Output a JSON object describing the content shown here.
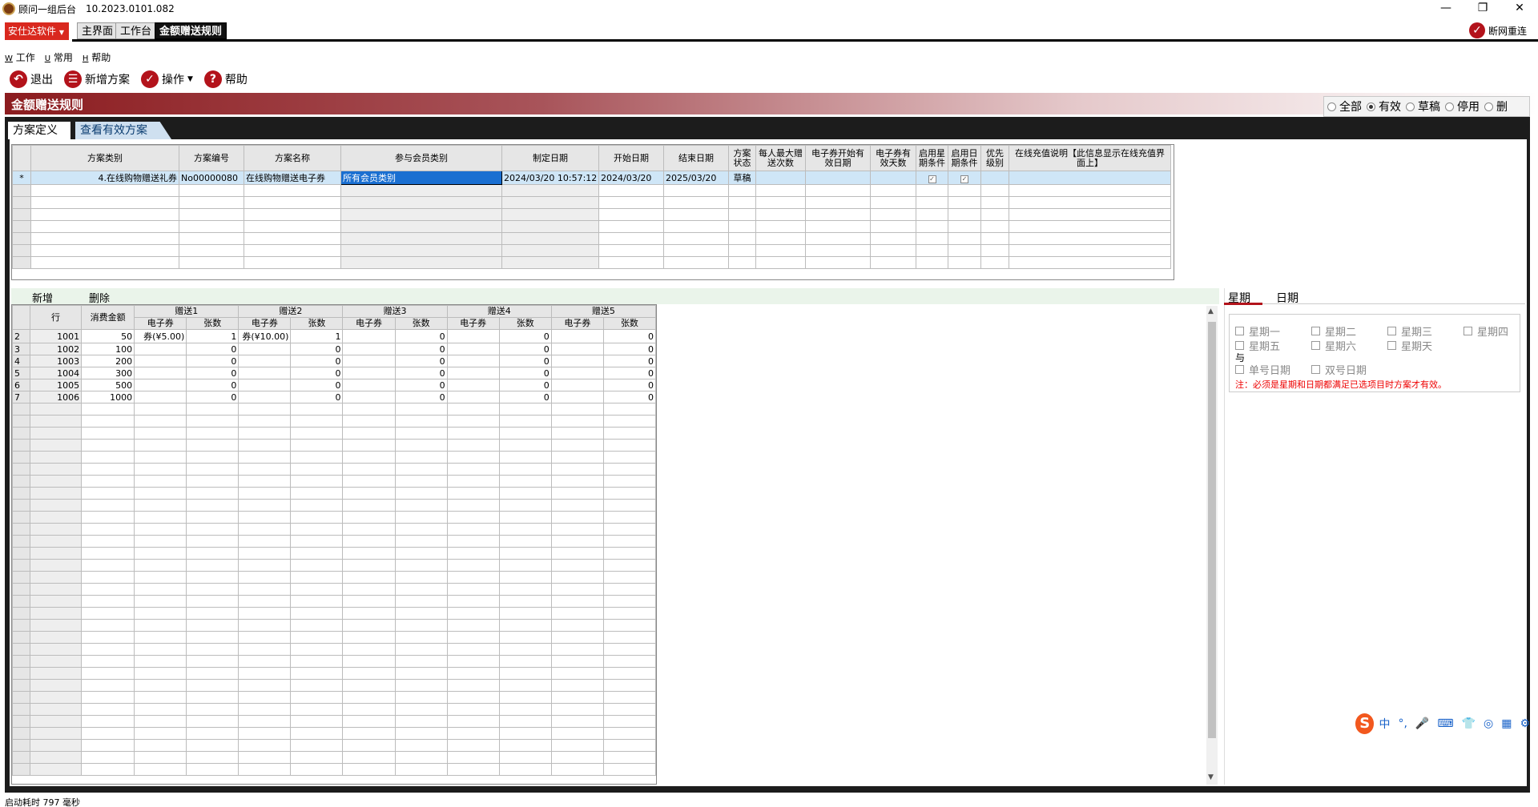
{
  "window": {
    "title": "顾问一组后台",
    "version": "10.2023.0101.082",
    "min": "—",
    "restore": "❐",
    "close": "✕"
  },
  "app_tabs": {
    "brand": "安仕达软件",
    "tabs": [
      {
        "label": "主界面"
      },
      {
        "label": "工作台"
      },
      {
        "label": "金额赠送规则"
      }
    ],
    "reconnect": "断网重连"
  },
  "menu": [
    {
      "key": "W",
      "label": "工作"
    },
    {
      "key": "U",
      "label": "常用"
    },
    {
      "key": "H",
      "label": "帮助"
    }
  ],
  "toolbar": {
    "exit": "退出",
    "new_plan": "新增方案",
    "operate": "操作",
    "help": "帮助"
  },
  "banner": {
    "title": "金额赠送规则"
  },
  "filter": {
    "options": [
      "全部",
      "有效",
      "草稿",
      "停用",
      "删"
    ],
    "selected": "有效"
  },
  "subtabs": {
    "define": "方案定义",
    "view_valid": "查看有效方案"
  },
  "plan_grid": {
    "headers": [
      "方案类别",
      "方案编号",
      "方案名称",
      "参与会员类别",
      "制定日期",
      "开始日期",
      "结束日期",
      "方案状态",
      "每人最大赠送次数",
      "电子券开始有效日期",
      "电子券有效天数",
      "启用星期条件",
      "启用日期条件",
      "优先级别",
      "在线充值说明【此信息显示在线充值界面上】"
    ],
    "row": {
      "marker": "*",
      "category": "4.在线购物赠送礼券",
      "code": "No00000080",
      "name": "在线购物赠送电子券",
      "member": "所有会员类别",
      "made": "2024/03/20 10:57:12",
      "start": "2024/03/20",
      "end": "2025/03/20",
      "status": "草稿",
      "max": "",
      "coupon_start": "",
      "days": "",
      "week_on": true,
      "date_on": true,
      "priority": "",
      "note": ""
    }
  },
  "detail_toolbar": {
    "add": "新增",
    "delete": "删除"
  },
  "detail_grid": {
    "h_row": "行",
    "h_amount": "消费金额",
    "groups": [
      "赠送1",
      "赠送2",
      "赠送3",
      "赠送4",
      "赠送5"
    ],
    "sub_coupon": "电子券",
    "sub_count": "张数",
    "rows": [
      {
        "idx": "2",
        "row": "1001",
        "amount": "50",
        "c": [
          "券(¥5.00)",
          "券(¥10.00)",
          "",
          "",
          ""
        ],
        "n": [
          "1",
          "1",
          "0",
          "0",
          "0"
        ]
      },
      {
        "idx": "3",
        "row": "1002",
        "amount": "100",
        "c": [
          "",
          "",
          "",
          "",
          ""
        ],
        "n": [
          "0",
          "0",
          "0",
          "0",
          "0"
        ]
      },
      {
        "idx": "4",
        "row": "1003",
        "amount": "200",
        "c": [
          "",
          "",
          "",
          "",
          ""
        ],
        "n": [
          "0",
          "0",
          "0",
          "0",
          "0"
        ]
      },
      {
        "idx": "5",
        "row": "1004",
        "amount": "300",
        "c": [
          "",
          "",
          "",
          "",
          ""
        ],
        "n": [
          "0",
          "0",
          "0",
          "0",
          "0"
        ]
      },
      {
        "idx": "6",
        "row": "1005",
        "amount": "500",
        "c": [
          "",
          "",
          "",
          "",
          ""
        ],
        "n": [
          "0",
          "0",
          "0",
          "0",
          "0"
        ]
      },
      {
        "idx": "7",
        "row": "1006",
        "amount": "1000",
        "c": [
          "",
          "",
          "",
          "",
          ""
        ],
        "n": [
          "0",
          "0",
          "0",
          "0",
          "0"
        ]
      }
    ]
  },
  "right_panel": {
    "tab_week": "星期",
    "tab_date": "日期",
    "days": [
      "星期一",
      "星期二",
      "星期三",
      "星期四",
      "星期五",
      "星期六",
      "星期天"
    ],
    "and": "与",
    "odd": "单号日期",
    "even": "双号日期",
    "note": "注：必须是星期和日期都满足已选项目时方案才有效。"
  },
  "status": {
    "text": "启动耗时 797 毫秒"
  },
  "ime": {
    "logo": "S",
    "lang": "中",
    "punct": "°,",
    "mic": "🎤",
    "kb": "⌨",
    "shirt": "👕",
    "game": "◎",
    "grid": "▦",
    "gear": "⚙"
  }
}
